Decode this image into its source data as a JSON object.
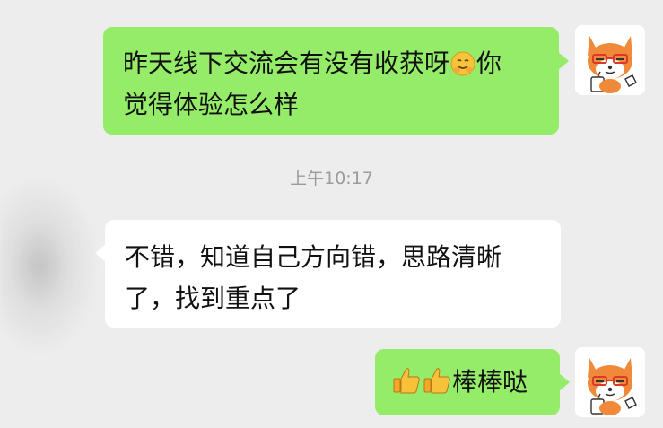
{
  "conversation": {
    "messages": [
      {
        "side": "sent",
        "line1": "昨天线下交流会有没有收获呀",
        "emoji": "hug-emoji",
        "line1_tail": "你",
        "line2": "觉得体验怎么样"
      },
      {
        "side": "received",
        "line1": "不错，知道自己方向错，思路清晰",
        "line2": "了，找到重点了"
      },
      {
        "side": "sent",
        "emojis": [
          "thumbs-up-emoji",
          "thumbs-up-emoji"
        ],
        "text": "棒棒哒"
      }
    ],
    "timestamp": "上午10:17"
  },
  "colors": {
    "sent_bubble": "#95ec69",
    "received_bubble": "#ffffff",
    "background": "#ededed",
    "timestamp_text": "#9b9b9b"
  }
}
